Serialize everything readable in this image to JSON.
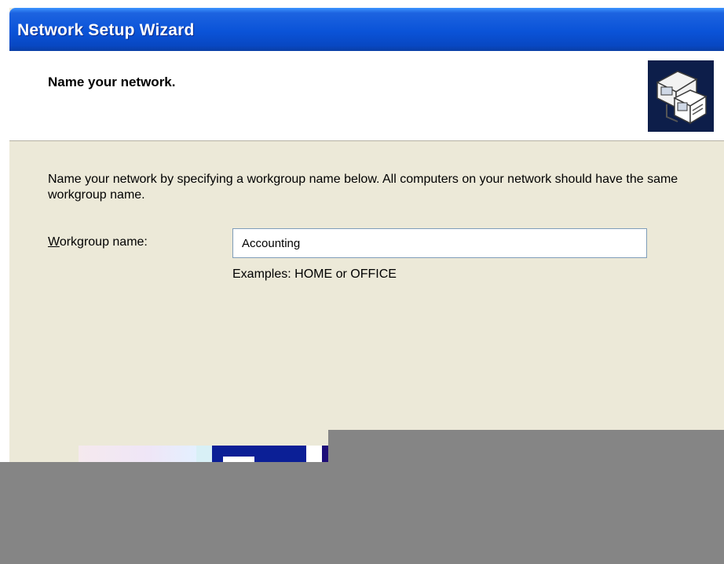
{
  "window": {
    "title": "Network Setup Wizard"
  },
  "header": {
    "title": "Name your network.",
    "icon": "network-computers-icon"
  },
  "content": {
    "description": "Name your network by specifying a workgroup name below. All computers on your network should have the same workgroup name.",
    "workgroup": {
      "label_accel": "W",
      "label_rest": "orkgroup name:",
      "value": "Accounting",
      "examples": "Examples: HOME or OFFICE"
    }
  },
  "colors": {
    "titlebar": "#0a53d8",
    "dialog_background": "#ece9d8",
    "input_border": "#7f9db9",
    "obscured_region": "#858585"
  }
}
